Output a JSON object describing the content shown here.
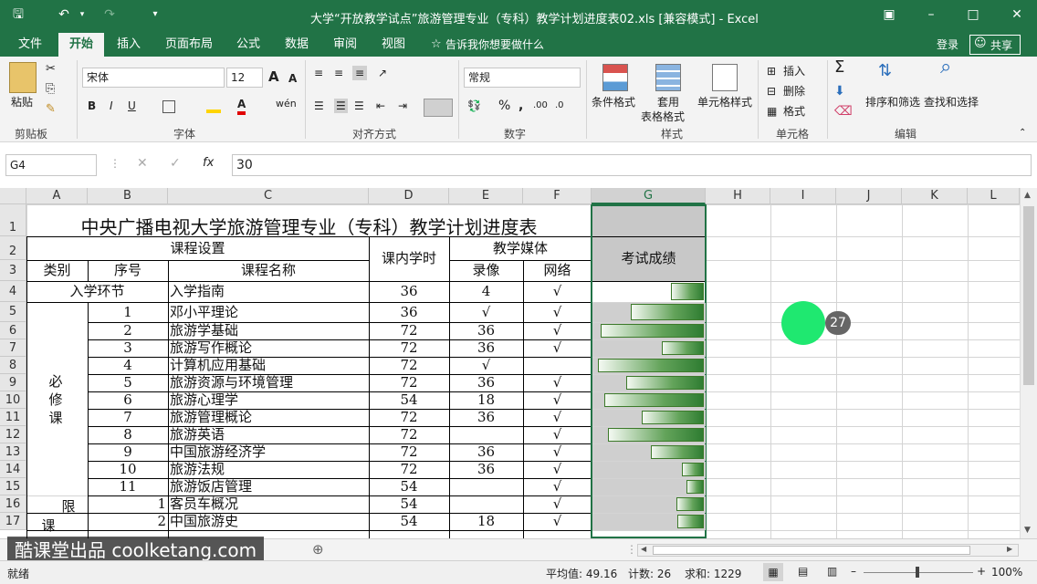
{
  "titlebar": {
    "title": "大学“开放教学试点”旅游管理专业（专科）教学计划进度表02.xls  [兼容模式] - Excel"
  },
  "tabs": [
    {
      "label": "文件"
    },
    {
      "label": "开始"
    },
    {
      "label": "插入"
    },
    {
      "label": "页面布局"
    },
    {
      "label": "公式"
    },
    {
      "label": "数据"
    },
    {
      "label": "审阅"
    },
    {
      "label": "视图"
    }
  ],
  "tellme": "告诉我你想要做什么",
  "login": "登录",
  "share": "共享",
  "ribbon": {
    "paste": "粘贴",
    "font_name": "宋体",
    "font_size": "12",
    "number_format": "常规",
    "cond_format": "条件格式",
    "table_format_1": "套用",
    "table_format_2": "表格格式",
    "cell_style": "单元格样式",
    "insert": "插入",
    "delete": "删除",
    "format": "格式",
    "sort_filter": "排序和筛选",
    "find_select": "查找和选择",
    "groups": {
      "clipboard": "剪贴板",
      "font": "字体",
      "align": "对齐方式",
      "number": "数字",
      "styles": "样式",
      "cells": "单元格",
      "edit": "编辑"
    }
  },
  "formula": {
    "cell_ref": "G4",
    "value": "30",
    "fx": "fx"
  },
  "columns": [
    "A",
    "B",
    "C",
    "D",
    "E",
    "F",
    "G",
    "H",
    "I",
    "J",
    "K",
    "L"
  ],
  "rows": [
    "1",
    "2",
    "3",
    "4",
    "5",
    "6",
    "7",
    "8",
    "9",
    "10",
    "11",
    "12",
    "13",
    "14",
    "15",
    "16",
    "17"
  ],
  "sheet": {
    "title": "中央广播电视大学旅游管理专业（专科）教学计划进度表",
    "h_course_setup": "课程设置",
    "h_hours": "课内学时",
    "h_media": "教学媒体",
    "h_exam": "考试成绩",
    "h_type": "类别",
    "h_seq": "序号",
    "h_name": "课程名称",
    "h_video": "录像",
    "h_net": "网络",
    "entry_section": "入学环节",
    "required_label": [
      "必",
      "修",
      "课"
    ],
    "limited_label": [
      "限",
      "课"
    ],
    "body": [
      {
        "seq": "",
        "name": "入学指南",
        "hours": "36",
        "video": "4",
        "net": "√",
        "score": 30
      },
      {
        "seq": "1",
        "name": "邓小平理论",
        "hours": "36",
        "video": "√",
        "net": "√",
        "score": 66
      },
      {
        "seq": "2",
        "name": "旅游学基础",
        "hours": "72",
        "video": "36",
        "net": "√",
        "score": 93
      },
      {
        "seq": "3",
        "name": "旅游写作概论",
        "hours": "72",
        "video": "36",
        "net": "√",
        "score": 38
      },
      {
        "seq": "4",
        "name": "计算机应用基础",
        "hours": "72",
        "video": "√",
        "net": "",
        "score": 96
      },
      {
        "seq": "5",
        "name": "旅游资源与环境管理",
        "hours": "72",
        "video": "36",
        "net": "√",
        "score": 70
      },
      {
        "seq": "6",
        "name": "旅游心理学",
        "hours": "54",
        "video": "18",
        "net": "√",
        "score": 90
      },
      {
        "seq": "7",
        "name": "旅游管理概论",
        "hours": "72",
        "video": "36",
        "net": "√",
        "score": 56
      },
      {
        "seq": "8",
        "name": "旅游英语",
        "hours": "72",
        "video": "",
        "net": "√",
        "score": 87
      },
      {
        "seq": "9",
        "name": "中国旅游经济学",
        "hours": "72",
        "video": "36",
        "net": "√",
        "score": 48
      },
      {
        "seq": "10",
        "name": "旅游法规",
        "hours": "72",
        "video": "36",
        "net": "√",
        "score": 20
      },
      {
        "seq": "11",
        "name": "旅游饭店管理",
        "hours": "54",
        "video": "",
        "net": "√",
        "score": 16
      },
      {
        "seq": "1",
        "name": "客员车概况",
        "hours": "54",
        "video": "",
        "net": "√",
        "score": 25
      },
      {
        "seq": "2",
        "name": "中国旅游史",
        "hours": "54",
        "video": "18",
        "net": "√",
        "score": 24
      }
    ]
  },
  "click_badge": "27",
  "watermark": "酷课堂出品 coolketang.com",
  "status": {
    "ready": "就绪",
    "average": "平均值: 49.16",
    "count": "计数: 26",
    "sum": "求和: 1229",
    "zoom": "100%"
  },
  "colors": {
    "excel_green": "#217346",
    "bar_green": "#3c7a2a",
    "click_circle": "#1fe870"
  }
}
